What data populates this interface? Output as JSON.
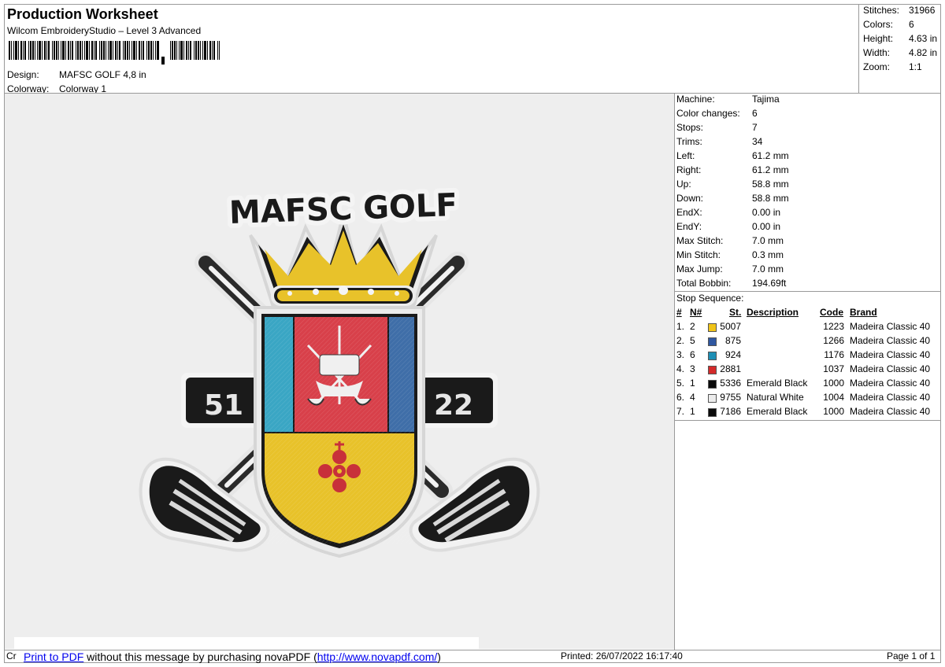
{
  "header": {
    "title": "Production Worksheet",
    "subtitle": "Wilcom EmbroideryStudio – Level 3 Advanced",
    "design_label": "Design:",
    "design_value": "MAFSC GOLF 4,8 in",
    "colorway_label": "Colorway:",
    "colorway_value": "Colorway 1"
  },
  "stats": [
    {
      "label": "Stitches:",
      "value": "31966"
    },
    {
      "label": "Colors:",
      "value": "6"
    },
    {
      "label": "Height:",
      "value": "4.63 in"
    },
    {
      "label": "Width:",
      "value": "4.82 in"
    },
    {
      "label": "Zoom:",
      "value": "1:1"
    }
  ],
  "machine": [
    {
      "label": "Machine:",
      "value": "Tajima"
    },
    {
      "label": "Color changes:",
      "value": "6"
    },
    {
      "label": "Stops:",
      "value": "7"
    },
    {
      "label": "Trims:",
      "value": "34"
    },
    {
      "label": "Left:",
      "value": "61.2 mm"
    },
    {
      "label": "Right:",
      "value": "61.2 mm"
    },
    {
      "label": "Up:",
      "value": "58.8 mm"
    },
    {
      "label": "Down:",
      "value": "58.8 mm"
    },
    {
      "label": "EndX:",
      "value": "0.00 in"
    },
    {
      "label": "EndY:",
      "value": "0.00 in"
    },
    {
      "label": "Max Stitch:",
      "value": "7.0 mm"
    },
    {
      "label": "Min Stitch:",
      "value": "0.3 mm"
    },
    {
      "label": "Max Jump:",
      "value": "7.0 mm"
    },
    {
      "label": "Total Bobbin:",
      "value": "194.69ft"
    }
  ],
  "stop_sequence": {
    "title": "Stop Sequence:",
    "headers": [
      "#",
      "N#",
      "St.",
      "Description",
      "Code",
      "Brand"
    ],
    "rows": [
      {
        "num": "1.",
        "n": "2",
        "color": "#f0c419",
        "st": "5007",
        "desc": "",
        "code": "1223",
        "brand": "Madeira Classic 40"
      },
      {
        "num": "2.",
        "n": "5",
        "color": "#2f57a0",
        "st": "875",
        "desc": "",
        "code": "1266",
        "brand": "Madeira Classic 40"
      },
      {
        "num": "3.",
        "n": "6",
        "color": "#1e8fb5",
        "st": "924",
        "desc": "",
        "code": "1176",
        "brand": "Madeira Classic 40"
      },
      {
        "num": "4.",
        "n": "3",
        "color": "#d42a2a",
        "st": "2881",
        "desc": "",
        "code": "1037",
        "brand": "Madeira Classic 40"
      },
      {
        "num": "5.",
        "n": "1",
        "color": "#0a0a0a",
        "st": "5336",
        "desc": "Emerald Black",
        "code": "1000",
        "brand": "Madeira Classic 40"
      },
      {
        "num": "6.",
        "n": "4",
        "color": "#ececec",
        "st": "9755",
        "desc": "Natural White",
        "code": "1004",
        "brand": "Madeira Classic 40"
      },
      {
        "num": "7.",
        "n": "1",
        "color": "#0a0a0a",
        "st": "7186",
        "desc": "Emerald Black",
        "code": "1000",
        "brand": "Madeira Classic 40"
      }
    ]
  },
  "design": {
    "logo_text": "MAFSC GOLF",
    "left_number": "51",
    "right_number": "22",
    "colors": {
      "yellow": "#e8c22a",
      "red": "#d8404a",
      "blue_left": "#3aa6c4",
      "blue_right": "#3f6ea8",
      "black": "#1a1a1a",
      "white": "#f4f4f4",
      "ornament_red": "#c8303a"
    }
  },
  "footer": {
    "left": "Cr",
    "link1": "Print to PDF",
    "msg": " without this message by purchasing novaPDF (",
    "link2": "http://www.novapdf.com/",
    "msg_end": ")",
    "printed": "Printed: 26/07/2022 16:17:40",
    "page": "Page 1 of 1"
  }
}
